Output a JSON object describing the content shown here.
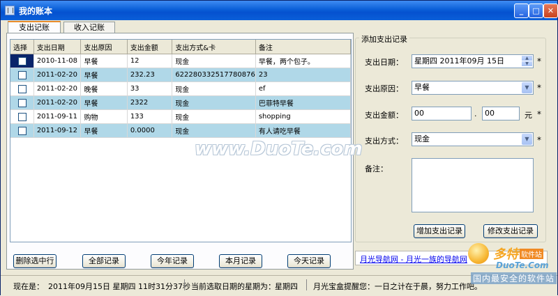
{
  "window": {
    "title": "我的账本",
    "controls": {
      "minimize": "_",
      "maximize": "□",
      "close": "✕"
    }
  },
  "tabs": [
    {
      "label": "支出记账",
      "active": true
    },
    {
      "label": "收入记账",
      "active": false
    }
  ],
  "table": {
    "columns": [
      "选择",
      "支出日期",
      "支出原因",
      "支出金额",
      "支出方式&卡",
      "备注"
    ],
    "rows": [
      {
        "date": "2010-11-08",
        "reason": "早餐",
        "amount": "12",
        "method": "现金",
        "note": "早餐，两个包子。",
        "highlight": false,
        "selected": true
      },
      {
        "date": "2011-02-20",
        "reason": "早餐",
        "amount": "232.23",
        "method": "622280332517780876",
        "note": "23",
        "highlight": true,
        "selected": false
      },
      {
        "date": "2011-02-20",
        "reason": "晚餐",
        "amount": "33",
        "method": "现金",
        "note": "ef",
        "highlight": false,
        "selected": false
      },
      {
        "date": "2011-02-20",
        "reason": "早餐",
        "amount": "2322",
        "method": "现金",
        "note": "巴菲特早餐",
        "highlight": true,
        "selected": false
      },
      {
        "date": "2011-09-11",
        "reason": "购物",
        "amount": "133",
        "method": "现金",
        "note": "shopping",
        "highlight": false,
        "selected": false
      },
      {
        "date": "2011-09-12",
        "reason": "早餐",
        "amount": "0.0000",
        "method": "现金",
        "note": "有人请吃早餐",
        "highlight": true,
        "selected": false
      }
    ]
  },
  "buttons": {
    "delete_selected": "删除选中行",
    "all_records": "全部记录",
    "year_records": "今年记录",
    "month_records": "本月记录",
    "today_records": "今天记录"
  },
  "form": {
    "group_title": "添加支出记录",
    "date_label": "支出日期：",
    "date_value": "星期四  2011年09月 15日",
    "reason_label": "支出原因：",
    "reason_value": "早餐",
    "amount_label": "支出金额：",
    "amount_int": "00",
    "amount_dot": ".",
    "amount_dec": "00",
    "amount_unit": "元",
    "method_label": "支出方式：",
    "method_value": "现金",
    "note_label": "备注：",
    "required_mark": "*",
    "add_button": "增加支出记录",
    "edit_button": "修改支出记录"
  },
  "link": {
    "text": "月光导航网 - 月光一族的导航网"
  },
  "status": {
    "now_label": "现在是：",
    "now_value": "2011年09月15日  星期四 11时31分37秒",
    "weekday_label": "当前选取日期的星期为：",
    "weekday_value": "星期四",
    "tip": "月光宝盒提醒您：一日之计在于晨，努力工作吧。"
  },
  "watermark": "www.DuoTe.com",
  "logo": {
    "main": "多特",
    "sub": "软件站",
    "domain": "DuoTe.Com",
    "tagline": "国内最安全的软件站"
  },
  "colors": {
    "title_bar": "#0a5fd8",
    "row_highlight": "#b0d8e8",
    "link": "#0000ee"
  }
}
